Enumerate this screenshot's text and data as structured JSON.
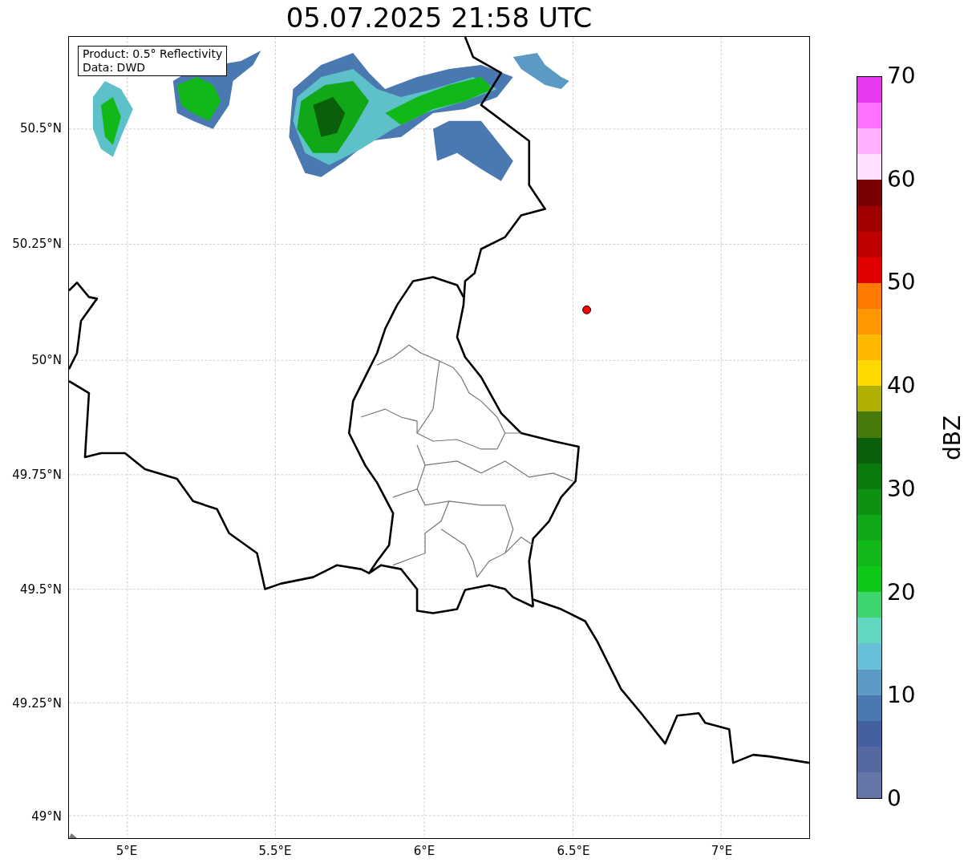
{
  "title": "05.07.2025 21:58 UTC",
  "info_box": [
    "Product: 0.5° Reflectivity",
    "Data: DWD"
  ],
  "map": {
    "lat_ticks": [
      "50.5°N",
      "50.25°N",
      "50°N",
      "49.75°N",
      "49.5°N",
      "49.25°N",
      "49°N"
    ],
    "lon_ticks": [
      "5°E",
      "5.5°E",
      "6°E",
      "6.5°E",
      "7°E"
    ]
  },
  "colorbar": {
    "label": "dBZ",
    "ticks": [
      "70",
      "60",
      "50",
      "40",
      "30",
      "20",
      "10",
      "0"
    ],
    "segments": [
      {
        "color": "#e838f0"
      },
      {
        "color": "#ff70ff"
      },
      {
        "color": "#ffb0ff"
      },
      {
        "color": "#ffe0ff"
      },
      {
        "color": "#780000"
      },
      {
        "color": "#a00000"
      },
      {
        "color": "#c00000"
      },
      {
        "color": "#e00000"
      },
      {
        "color": "#ff7800"
      },
      {
        "color": "#ff9800"
      },
      {
        "color": "#ffb800"
      },
      {
        "color": "#ffd800"
      },
      {
        "color": "#b0b000"
      },
      {
        "color": "#467a0a"
      },
      {
        "color": "#0a600a"
      },
      {
        "color": "#0a7a0a"
      },
      {
        "color": "#0e9010"
      },
      {
        "color": "#10a818"
      },
      {
        "color": "#10b818"
      },
      {
        "color": "#10c818"
      },
      {
        "color": "#3dd66e"
      },
      {
        "color": "#60d8c0"
      },
      {
        "color": "#68c0d8"
      },
      {
        "color": "#5a9ac4"
      },
      {
        "color": "#4a78b0"
      },
      {
        "color": "#4560a0"
      },
      {
        "color": "#5568a0"
      },
      {
        "color": "#6675a8"
      }
    ]
  }
}
